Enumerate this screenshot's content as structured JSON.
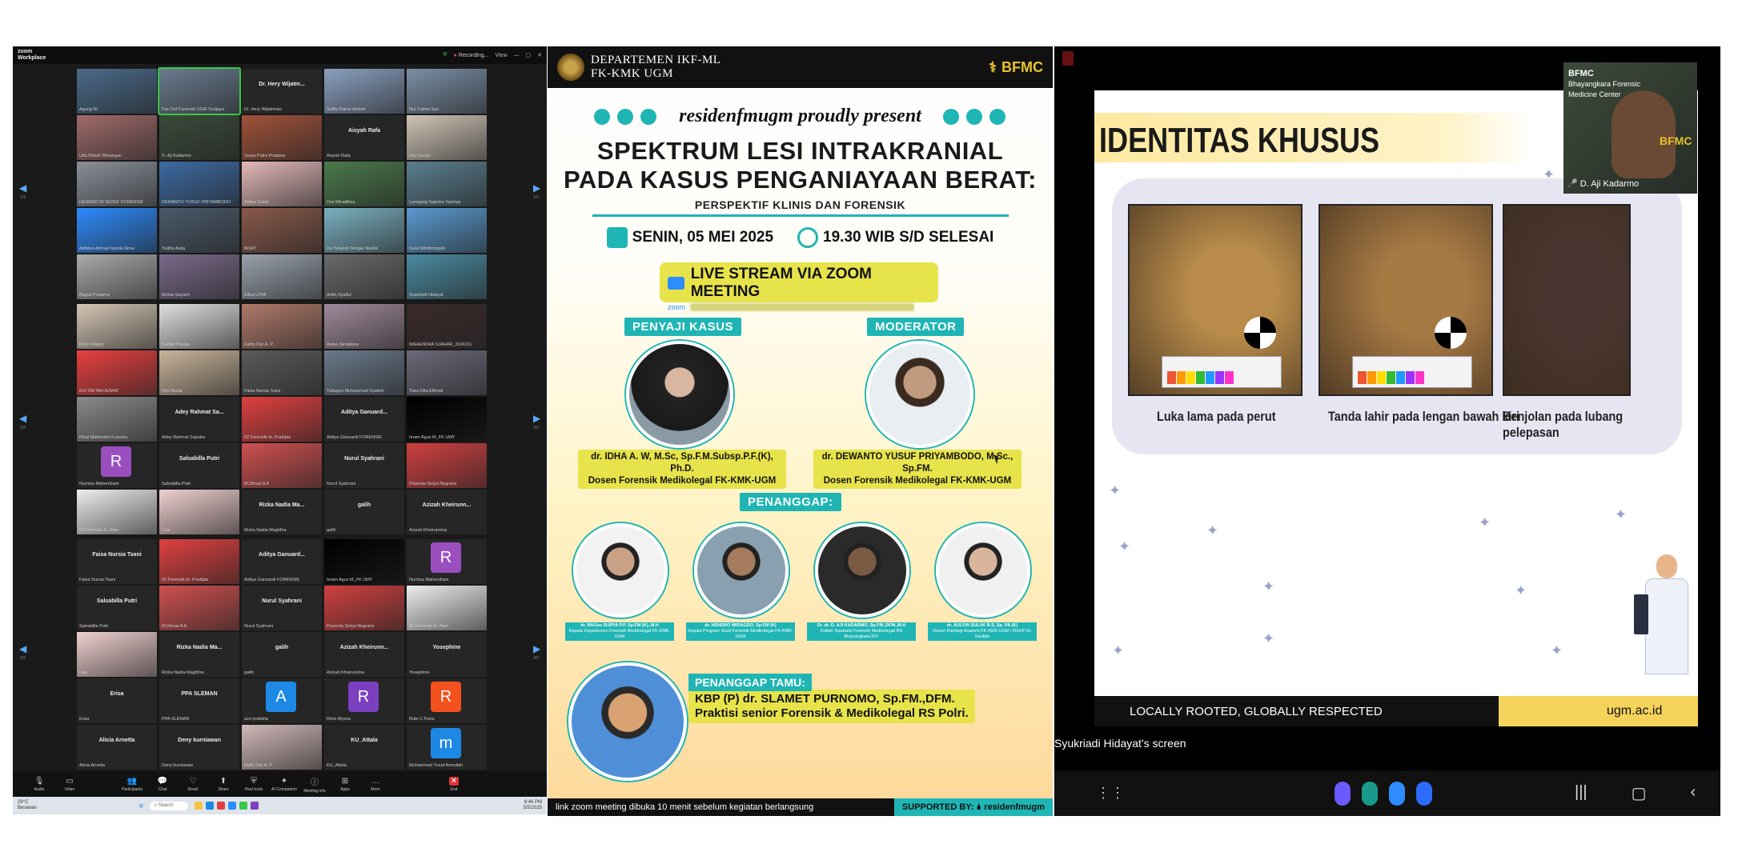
{
  "zoom": {
    "brand_line1": "zoom",
    "brand_line2": "Workplace",
    "recording": "Recording...",
    "view": "View",
    "page_counters": [
      "1/3",
      "2/3",
      "3/3"
    ],
    "tiles_page1": [
      {
        "name": "Agung W.",
        "type": "video",
        "color": "#4a6a8a"
      },
      {
        "name": "Fan Def Forensik UGM Sudjaya",
        "type": "video",
        "color": "#6a7c8f",
        "hl": true
      },
      {
        "name": "Dr. Hery Wijatmoko",
        "type": "text",
        "big": "Dr. Hery Wijatm..."
      },
      {
        "name": "Saffia Fairuz Azizah",
        "type": "video",
        "color": "#8aa0c0"
      },
      {
        "name": "Nur Fatma Sari",
        "type": "video",
        "color": "#7a8fa5"
      },
      {
        "name": "Ulfa Rifaeli Winangun",
        "type": "video",
        "color": "#a06a6a"
      },
      {
        "name": "D. Aji Kadarmo",
        "type": "video",
        "color": "#3a4a3a"
      },
      {
        "name": "Surya Putra Pradana",
        "type": "video",
        "color": "#a0523a"
      },
      {
        "name": "Aisyah Rafa",
        "type": "text",
        "big": "Aisyah Rafa"
      },
      {
        "name": "Dey Sergio",
        "type": "video",
        "color": "#cfc5b6"
      },
      {
        "name": "HENDRO W SEDEF FORENSIK",
        "type": "video",
        "color": "#8a8f99"
      },
      {
        "name": "DEWANTO YUSUF PRIYAMBODO",
        "type": "video",
        "color": "#3d6aa2"
      },
      {
        "name": "Aditya Sukdi",
        "type": "video",
        "color": "#e3b8b8"
      },
      {
        "name": "Dwi Wiraditma",
        "type": "video",
        "color": "#4a7a4a"
      },
      {
        "name": "Lampang Saputra Yasinya",
        "type": "video",
        "color": "#5a7f8f"
      },
      {
        "name": "Adhitya Ahmad Nanda Nova",
        "type": "video",
        "color": "#2d8cff"
      },
      {
        "name": "Yudha Aulia",
        "type": "video",
        "color": "#4a5a6a"
      },
      {
        "name": "BORY",
        "type": "video",
        "color": "#8a5a4a"
      },
      {
        "name": "Ira Yuliandi Dengar Nuklisi",
        "type": "video",
        "color": "#7ab0c0"
      },
      {
        "name": "Dewi Wiridiningsih",
        "type": "video",
        "color": "#5a9ad0"
      },
      {
        "name": "Bagus Pratama",
        "type": "video",
        "color": "#aaaaaa"
      },
      {
        "name": "Monia Sayanti",
        "type": "video",
        "color": "#7a6a8a"
      },
      {
        "name": "Elfira UTMI",
        "type": "video",
        "color": "#9aa2ad"
      },
      {
        "name": "Arifin Syaiful",
        "type": "video",
        "color": "#6a6a6a"
      },
      {
        "name": "Syakriadi Hidayat",
        "type": "video",
        "color": "#4a8aa0"
      }
    ],
    "tiles_page2": [
      {
        "name": "Desti Vilapsi",
        "type": "video",
        "color": "#d4c6b4"
      },
      {
        "name": "Sardia Prasiwi",
        "type": "video",
        "color": "#e0e0e0"
      },
      {
        "name": "Fathy Dwi A. P.",
        "type": "video",
        "color": "#b07a6a"
      },
      {
        "name": "Anisa Jamaliana",
        "type": "video",
        "color": "#a08a9a"
      },
      {
        "name": "MAHENDRA SJAHAR_2024011",
        "type": "video",
        "color": "#3a2a2a"
      },
      {
        "name": "R/Z DIETAH AZMAT",
        "type": "video",
        "color": "#e84040"
      },
      {
        "name": "Riki Nazila",
        "type": "video",
        "color": "#c8b49a"
      },
      {
        "name": "Faisa Nursia Tsani",
        "type": "video",
        "color": "#5a5a5a"
      },
      {
        "name": "Tubagus Muhammad Syafiah",
        "type": "video",
        "color": "#6a7a8a"
      },
      {
        "name": "Tiara Dita Effendi",
        "type": "video",
        "color": "#6a6a7a"
      },
      {
        "name": "Rizal Mahendra Kusuma",
        "type": "video",
        "color": "#8a8a8a"
      },
      {
        "name": "Adey Rahmat Saputra",
        "type": "text",
        "big": "Adey Rahmat Sa..."
      },
      {
        "name": "02 Forensik dr. Pradipta",
        "type": "video",
        "color": "#e04040"
      },
      {
        "name": "Aditya Ganuardi FORENSIK",
        "type": "text",
        "big": "Aditya Ganuard..."
      },
      {
        "name": "Imam Agus M_FK UMY",
        "type": "video",
        "color": "#000000"
      },
      {
        "name": "Nurnisa Mahendrani",
        "type": "avatar",
        "letter": "R",
        "color": "#9b4fbf"
      },
      {
        "name": "Salsabilla Putri",
        "type": "text",
        "big": "Salsabilla Putri"
      },
      {
        "name": "M.Dimas A A",
        "type": "video",
        "color": "#d05050"
      },
      {
        "name": "Nurul Syahrani",
        "type": "text",
        "big": "Nurul Syahrani"
      },
      {
        "name": "Floventa Setya Nugraha",
        "type": "video",
        "color": "#d04040"
      },
      {
        "name": "02 Forensik dr. Rian",
        "type": "video",
        "color": "#eeeeee"
      },
      {
        "name": "Lala",
        "type": "video",
        "color": "#f0d0d0"
      },
      {
        "name": "Rizka Nadia Maghfira",
        "type": "text",
        "big": "Rizka Nadia Ma..."
      },
      {
        "name": "galih",
        "type": "text",
        "big": "galih"
      },
      {
        "name": "Azizah Khoirunnisa",
        "type": "text",
        "big": "Azizah Kheirunn..."
      }
    ],
    "tiles_page3": [
      {
        "name": "Faisa Nursia Tsani",
        "type": "text",
        "big": "Faisa Nursia Tsani"
      },
      {
        "name": "02 Forensik dr. Pradipta",
        "type": "video",
        "color": "#e04040"
      },
      {
        "name": "Aditya Ganuardi FORENSIK",
        "type": "text",
        "big": "Aditya Ganuard..."
      },
      {
        "name": "Imam Agus M_FK UMY",
        "type": "video",
        "color": "#000000"
      },
      {
        "name": "Nurnisa Mahendrani",
        "type": "avatar",
        "letter": "R",
        "color": "#9b4fbf"
      },
      {
        "name": "Salsabilla Putri",
        "type": "text",
        "big": "Salsabilla Putri"
      },
      {
        "name": "M.Dimas A A",
        "type": "video",
        "color": "#d05050"
      },
      {
        "name": "Nurul Syahrani",
        "type": "text",
        "big": "Nurul Syahrani"
      },
      {
        "name": "Floventa Setya Nugraha",
        "type": "video",
        "color": "#d04040"
      },
      {
        "name": "02 Forensik dr. Rian",
        "type": "video",
        "color": "#eeeeee"
      },
      {
        "name": "Lala",
        "type": "video",
        "color": "#f0d0d0"
      },
      {
        "name": "Rizka Nadia Maghfira",
        "type": "text",
        "big": "Rizka Nadia Ma..."
      },
      {
        "name": "galih",
        "type": "text",
        "big": "galih"
      },
      {
        "name": "Azizah Khoirunnisa",
        "type": "text",
        "big": "Azizah Kheirunn..."
      },
      {
        "name": "Yosephine",
        "type": "text",
        "big": "Yosephine"
      },
      {
        "name": "Erisa",
        "type": "text",
        "big": "Erisa"
      },
      {
        "name": "PPA SLEMAN",
        "type": "text",
        "big": "PPA SLEMAN"
      },
      {
        "name": "asri prakbita",
        "type": "avatar",
        "letter": "A",
        "color": "#1e88e5"
      },
      {
        "name": "Rinni Alyssa",
        "type": "avatar",
        "letter": "R",
        "color": "#7b3fbf"
      },
      {
        "name": "Rubi C Putra",
        "type": "avatar",
        "letter": "R",
        "color": "#f4511e"
      },
      {
        "name": "Alicia Arnetta",
        "type": "text",
        "big": "Alicia Arnetta"
      },
      {
        "name": "Deny kurniawan",
        "type": "text",
        "big": "Deny kurniawan"
      },
      {
        "name": "Raffy Dwi A. P.",
        "type": "video",
        "color": "#d0b8b8"
      },
      {
        "name": "KU_Attala",
        "type": "text",
        "big": "KU_Attala"
      },
      {
        "name": "Muhammad Yusuf Amrullah",
        "type": "avatar",
        "letter": "m",
        "color": "#1e88e5"
      }
    ],
    "toolbar": [
      {
        "label": "Audio",
        "icon": "microphone-icon",
        "glyph": "🎙"
      },
      {
        "label": "Video",
        "icon": "camera-icon",
        "glyph": "▭"
      },
      {
        "label": "Participants",
        "icon": "participants-icon",
        "glyph": "👥"
      },
      {
        "label": "Chat",
        "icon": "chat-icon",
        "glyph": "💬"
      },
      {
        "label": "React",
        "icon": "react-icon",
        "glyph": "♡"
      },
      {
        "label": "Share",
        "icon": "share-icon",
        "glyph": "⬆"
      },
      {
        "label": "Host tools",
        "icon": "shield-icon",
        "glyph": "⛨"
      },
      {
        "label": "AI Companion",
        "icon": "sparkle-icon",
        "glyph": "✦"
      },
      {
        "label": "Meeting info",
        "icon": "info-icon",
        "glyph": "ⓘ"
      },
      {
        "label": "Apps",
        "icon": "apps-icon",
        "glyph": "⊞"
      },
      {
        "label": "More",
        "icon": "more-icon",
        "glyph": "…"
      },
      {
        "label": "End",
        "icon": "end-icon",
        "glyph": "✕"
      }
    ],
    "taskbar": {
      "weather": "29°C",
      "weather_sub": "Berawan",
      "search": "Search",
      "time": "8:46 PM",
      "date": "5/5/2025"
    }
  },
  "poster": {
    "dept": "DEPARTEMEN IKF-ML",
    "faculty": "FK-KMK UGM",
    "bfmc": "BFMC",
    "present": "residenfmugm proudly present",
    "title_line1": "SPEKTRUM LESI INTRAKRANIAL",
    "title_line2": "PADA KASUS PENGANIAYAAN BERAT:",
    "subtitle": "PERSPEKTIF KLINIS DAN FORENSIK",
    "date": "SENIN, 05 MEI 2025",
    "time": "19.30 WIB S/D SELESAI",
    "live": "LIVE STREAM VIA ZOOM MEETING",
    "zoom_word": "zoom",
    "presenter_tag": "PENYAJI KASUS",
    "moderator_tag": "MODERATOR",
    "presenter_name": "dr. IDHA A. W, M.Sc, Sp.F.M.Subsp.P.F.(K), Ph.D.",
    "presenter_role": "Dosen Forensik Medikolegal FK-KMK-UGM",
    "moderator_name": "dr. DEWANTO YUSUF PRIYAMBODO, M.Sc., Sp.FM.",
    "moderator_role": "Dosen Forensik Medikolegal FK-KMK-UGM",
    "responder_tag": "PENANGGAP:",
    "responders": [
      {
        "name": "dr. BAGus SURYA P.P, Sp.FM (K).,M.H",
        "role": "Kepala Departemen Forensik Medikolegal FK-KMK-UGM"
      },
      {
        "name": "dr. HENDRO WIDAGDO, Sp.FM (K)",
        "role": "Kepala Program Studi Forensik Medikolegal FK-KMK-UGM"
      },
      {
        "name": "Dr. dr. D. AJI KADARMO, Sp.FM.,DFM.,M.H",
        "role": "Dokter Spesialis Forensik Medikolegal RS Bhayangkara DIY"
      },
      {
        "name": "dr. AULIYA SULUK B.S, Sp. PA (K)",
        "role": "Dosen Patologi Anatomi FK-KMK UGM / RSUP Dr. Sardjito"
      }
    ],
    "guest_tag": "PENANGGAP TAMU:",
    "guest_line1": "KBP (P) dr. SLAMET PURNOMO, Sp.FM.,DFM.",
    "guest_line2": "Praktisi senior Forensik & Medikolegal RS Polri.",
    "footer_left": "link zoom meeting dibuka 10 menit sebelum kegiatan berlangsung",
    "footer_right": "SUPPORTED BY: 🌢 residenfmugm"
  },
  "share": {
    "slide_title": "IDENTITAS KHUSUS",
    "photos": [
      {
        "caption": "Luka lama pada perut",
        "color": "#b88b4a"
      },
      {
        "caption": "Tanda lahir pada lengan bawah kiri",
        "color": "#a77a44"
      },
      {
        "caption": "Benjolan pada lubang pelepasan",
        "color": "#4a3630"
      }
    ],
    "footer_left": "LOCALLY ROOTED, GLOBALLY RESPECTED",
    "footer_right": "ugm.ac.id",
    "self_cam_line1": "BFMC",
    "self_cam_line2": "Bhayangkara Forensic",
    "self_cam_line3": "Medicine Center",
    "self_cam_logo": "BFMC",
    "self_cam_name": "🎤 D. Aji Kadarmo",
    "share_label": "Syukriadi Hidayat's screen",
    "nav_grid": "⋮⋮",
    "nav_recent": "|||",
    "nav_home": "▢",
    "nav_back": "‹"
  }
}
